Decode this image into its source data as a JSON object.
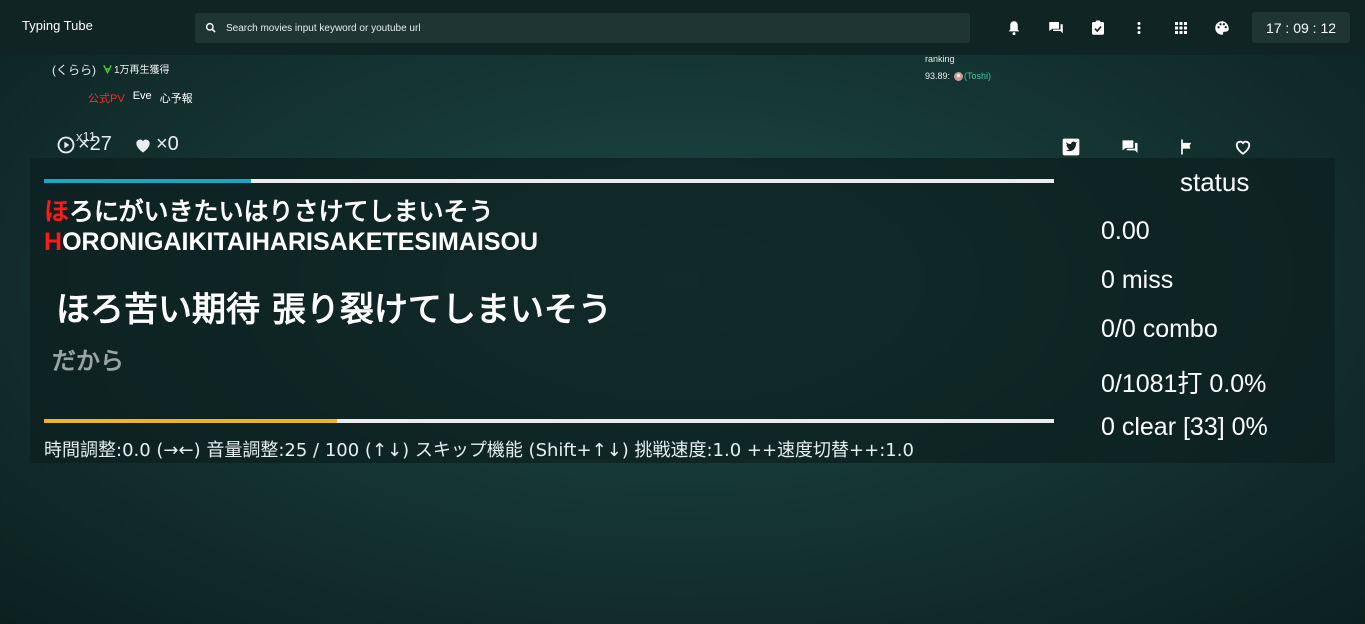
{
  "header": {
    "brand": "Typing Tube",
    "search_placeholder": "Search movies input keyword or youtube url",
    "clock": "17 : 09 : 12",
    "icons": [
      "bell-icon",
      "chat-icon",
      "checklist-icon",
      "more-vert-icon",
      "apps-grid-icon",
      "palette-icon"
    ]
  },
  "video_meta": {
    "artist_kana": "(くらら)",
    "award": "1万再生獲得",
    "tags": [
      {
        "label": "公式PV",
        "color": "#ff2a2a"
      },
      {
        "label": "Eve",
        "color": "#ffffff"
      },
      {
        "label": "心予報",
        "color": "#ffffff"
      }
    ],
    "plays_badge": "x11",
    "plays_count": "×27",
    "likes_count": "×0",
    "ranking_label": "ranking",
    "ranking_score": "93.89:",
    "ranking_user": "(Toshi)"
  },
  "typing": {
    "kana_typed": "ほ",
    "kana_rest": "ろにがいきたいはりさけてしまいそう",
    "roma_typed": "H",
    "roma_rest": "ORONIGAIKITAIHARISAKETESIMAISOU",
    "lyric_current": "ほろ苦い期待 張り裂けてしまいそう",
    "lyric_next": "だから",
    "line_progress": 0.205,
    "total_progress": 0.29,
    "hint": "時間調整:0.0 (→←) 音量調整:25 / 100 (↑↓) スキップ機能 (Shift+↑↓) 挑戦速度:1.0 ++速度切替++:1.0"
  },
  "status": {
    "title": "status",
    "score": "0.00",
    "miss": "0 miss",
    "combo": "0/0 combo",
    "keys": "0/1081打 0.0%",
    "clear": "0 clear [33] 0%"
  },
  "colors": {
    "accent_red": "#ff1a1a",
    "line_bar": "#1aa6c4",
    "total_bar": "#f0b429",
    "award_green": "#3ec93e",
    "ranking_user": "#3fc6a8"
  }
}
